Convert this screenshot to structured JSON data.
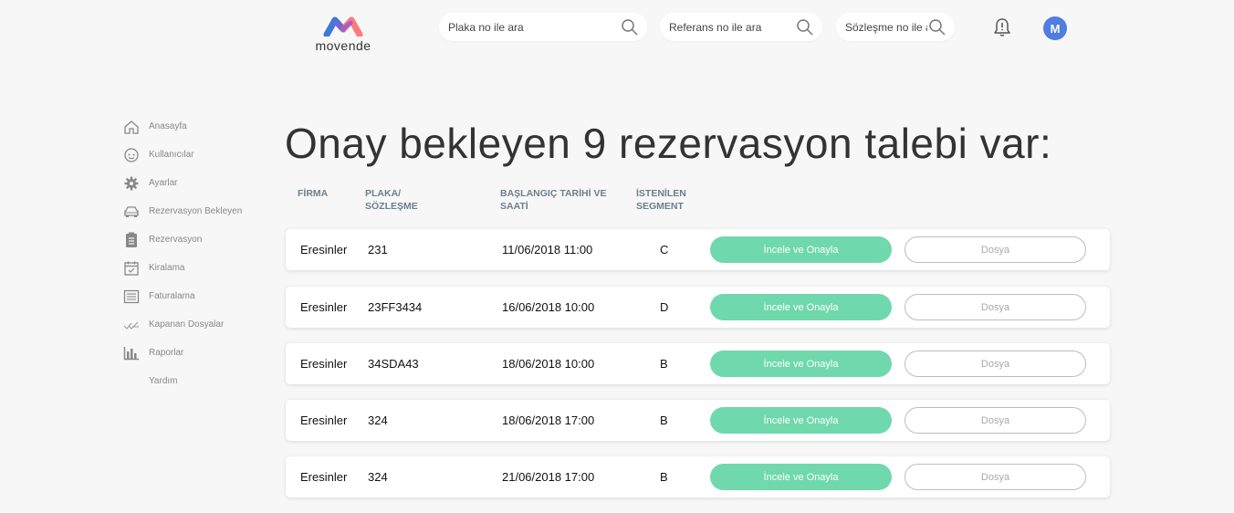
{
  "brand": {
    "name": "movende"
  },
  "search": [
    {
      "placeholder": "Plaka no ile ara"
    },
    {
      "placeholder": "Referans no ile ara"
    },
    {
      "placeholder": "Sözleşme no ile ara"
    }
  ],
  "user": {
    "initial": "M"
  },
  "sidebar": {
    "items": [
      {
        "label": "Anasayfa",
        "icon": "home-icon"
      },
      {
        "label": "Kullanıcılar",
        "icon": "users-icon"
      },
      {
        "label": "Ayarlar",
        "icon": "gear-icon"
      },
      {
        "label": "Rezervasyon Bekleyen",
        "icon": "car-icon"
      },
      {
        "label": "Rezervasyon",
        "icon": "clipboard-icon"
      },
      {
        "label": "Kiralama",
        "icon": "calendar-icon"
      },
      {
        "label": "Faturalama",
        "icon": "invoice-icon"
      },
      {
        "label": "Kapanan Dosyalar",
        "icon": "check-icon"
      },
      {
        "label": "Raporlar",
        "icon": "bar-chart-icon"
      },
      {
        "label": "Yardım",
        "icon": ""
      }
    ]
  },
  "main": {
    "title": "Onay bekleyen 9 rezervasyon talebi var:",
    "headers": {
      "firma": "FİRMA",
      "plaka_1": "PLAKA/",
      "plaka_2": "SÖZLEŞME",
      "tarih_1": "BAŞLANGIÇ TARİHİ VE",
      "tarih_2": "SAATİ",
      "segment_1": "İSTENİLEN",
      "segment_2": "SEGMENT"
    },
    "rows": [
      {
        "firma": "Eresinler",
        "plaka": "231",
        "tarih": "11/06/2018 11:00",
        "segment": "C",
        "approve": "İncele ve Onayla",
        "file": "Dosya"
      },
      {
        "firma": "Eresinler",
        "plaka": "23FF3434",
        "tarih": "16/06/2018 10:00",
        "segment": "D",
        "approve": "İncele ve Onayla",
        "file": "Dosya"
      },
      {
        "firma": "Eresinler",
        "plaka": "34SDA43",
        "tarih": "18/06/2018 10:00",
        "segment": "B",
        "approve": "İncele ve Onayla",
        "file": "Dosya"
      },
      {
        "firma": "Eresinler",
        "plaka": "324",
        "tarih": "18/06/2018 17:00",
        "segment": "B",
        "approve": "İncele ve Onayla",
        "file": "Dosya"
      },
      {
        "firma": "Eresinler",
        "plaka": "324",
        "tarih": "21/06/2018 17:00",
        "segment": "B",
        "approve": "İncele ve Onayla",
        "file": "Dosya"
      }
    ]
  },
  "colors": {
    "accent": "#6fd8ad",
    "avatar": "#4f7de0"
  }
}
